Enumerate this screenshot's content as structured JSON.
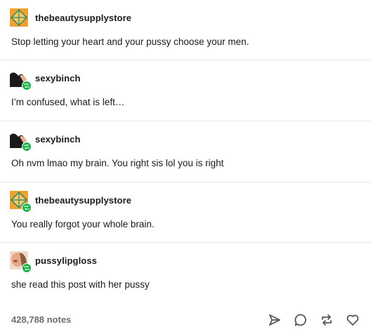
{
  "thread": [
    {
      "username": "thebeautysupplystore",
      "text": "Stop letting your heart and your pussy choose your men.",
      "avatar": "diamond-logo-icon",
      "reblogged": false
    },
    {
      "username": "sexybinch",
      "text": "I’m confused, what is left…",
      "avatar": "dark-photo-avatar",
      "reblogged": true
    },
    {
      "username": "sexybinch",
      "text": "Oh nvm lmao my brain. You right sis lol you is right",
      "avatar": "dark-photo-avatar",
      "reblogged": true
    },
    {
      "username": "thebeautysupplystore",
      "text": "You really forgot your whole brain.",
      "avatar": "diamond-logo-icon",
      "reblogged": true
    },
    {
      "username": "pussylipgloss",
      "text": "she read this post with her pussy",
      "avatar": "face-photo-avatar",
      "reblogged": true
    }
  ],
  "footer": {
    "notes": "428,788 notes",
    "actions": [
      "share-icon",
      "reply-icon",
      "reblog-icon",
      "like-icon"
    ]
  },
  "colors": {
    "reblog_badge": "#19b34a",
    "divider": "#e6e6e6",
    "notes_text": "#6e6e6e",
    "diamond_orange": "#f0a030",
    "diamond_green": "#2e8b57"
  }
}
